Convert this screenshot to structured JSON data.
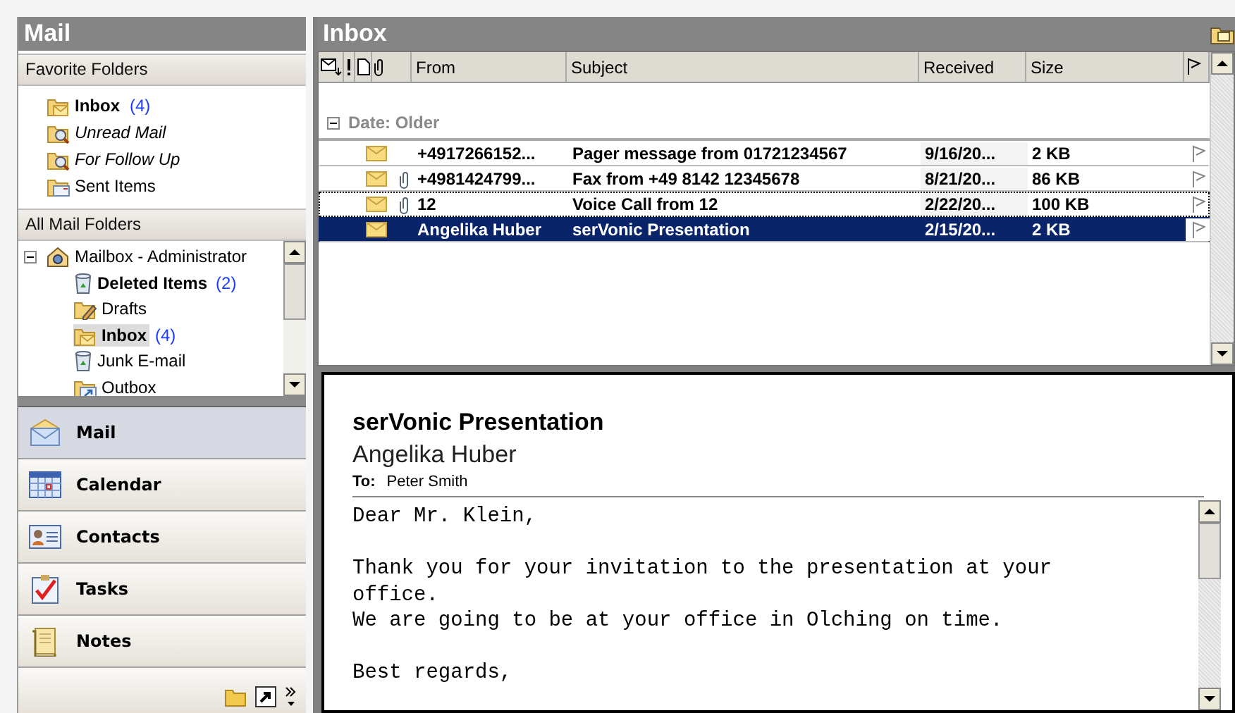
{
  "navigation_pane": {
    "title": "Mail",
    "favorite_folders": {
      "title": "Favorite Folders",
      "items": [
        {
          "kind": "mail",
          "label": "Inbox",
          "count": "(4)",
          "bold": true
        },
        {
          "kind": "search",
          "label": "Unread Mail",
          "bold": false
        },
        {
          "kind": "search",
          "label": "For Follow Up",
          "bold": false
        },
        {
          "kind": "sent",
          "label": "Sent Items",
          "bold": false
        }
      ]
    },
    "all_mail_folders": {
      "title": "All Mail Folders",
      "tree": [
        {
          "kind": "mailbox",
          "label": "Mailbox - Administrator",
          "expanded": true,
          "bold": false,
          "selected": false,
          "children": [
            {
              "kind": "trash",
              "label": "Deleted Items",
              "count": "(2)",
              "bold": true,
              "selected": false
            },
            {
              "kind": "drafts",
              "label": "Drafts",
              "bold": false,
              "selected": false
            },
            {
              "kind": "mail",
              "label": "Inbox",
              "count": "(4)",
              "bold": true,
              "selected": true
            },
            {
              "kind": "trash",
              "label": "Junk E-mail",
              "bold": false,
              "selected": false
            },
            {
              "kind": "outbox",
              "label": "Outbox",
              "bold": false,
              "selected": false
            }
          ]
        }
      ]
    },
    "buttons": [
      {
        "kind": "mail",
        "label": "Mail",
        "selected": true
      },
      {
        "kind": "calendar",
        "label": "Calendar",
        "selected": false
      },
      {
        "kind": "contacts",
        "label": "Contacts",
        "selected": false
      },
      {
        "kind": "tasks",
        "label": "Tasks",
        "selected": false
      },
      {
        "kind": "notes",
        "label": "Notes",
        "selected": false
      }
    ]
  },
  "message_list": {
    "title": "Inbox",
    "columns": [
      "From",
      "Subject",
      "Received",
      "Size"
    ],
    "group": {
      "label": "Date: Older",
      "expanded": true
    },
    "rows": [
      {
        "from": "+4917266152...",
        "subject": "Pager message from 01721234567",
        "received": "9/16/20...",
        "size": "2 KB",
        "attachment": false,
        "unread": true,
        "selected": false,
        "focused": false
      },
      {
        "from": "+4981424799...",
        "subject": "Fax from +49 8142 12345678",
        "received": "8/21/20...",
        "size": "86 KB",
        "attachment": true,
        "unread": true,
        "selected": false,
        "focused": false
      },
      {
        "from": "12",
        "subject": "Voice Call from 12",
        "received": "2/22/20...",
        "size": "100 KB",
        "attachment": true,
        "unread": true,
        "selected": false,
        "focused": true
      },
      {
        "from": "Angelika Huber",
        "subject": "serVonic Presentation",
        "received": "2/15/20...",
        "size": "2 KB",
        "attachment": false,
        "unread": true,
        "selected": true,
        "focused": false
      }
    ]
  },
  "reading_pane": {
    "subject": "serVonic Presentation",
    "sender": "Angelika Huber",
    "to_label": "To:",
    "to": "Peter Smith",
    "body": [
      [
        "Dear Mr. Klein,"
      ],
      [
        "Thank you for your invitation to the presentation at your office.",
        "We are going to be at your office in Olching on time."
      ],
      [
        "Best regards,"
      ]
    ]
  }
}
